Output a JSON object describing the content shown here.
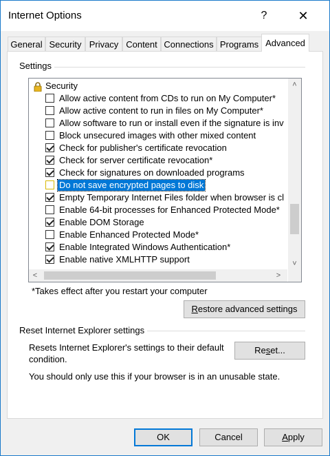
{
  "window": {
    "title": "Internet Options",
    "help_glyph": "?",
    "close_glyph": "✕"
  },
  "tabs": [
    {
      "label": "General"
    },
    {
      "label": "Security"
    },
    {
      "label": "Privacy"
    },
    {
      "label": "Content"
    },
    {
      "label": "Connections"
    },
    {
      "label": "Programs"
    },
    {
      "label": "Advanced",
      "active": true
    }
  ],
  "settings": {
    "group_label": "Settings",
    "category": {
      "label": "Security",
      "icon": "padlock-icon"
    },
    "items": [
      {
        "label": "Allow active content from CDs to run on My Computer*",
        "checked": false
      },
      {
        "label": "Allow active content to run in files on My Computer*",
        "checked": false
      },
      {
        "label": "Allow software to run or install even if the signature is inv",
        "checked": false
      },
      {
        "label": "Block unsecured images with other mixed content",
        "checked": false
      },
      {
        "label": "Check for publisher's certificate revocation",
        "checked": true
      },
      {
        "label": "Check for server certificate revocation*",
        "checked": true
      },
      {
        "label": "Check for signatures on downloaded programs",
        "checked": true
      },
      {
        "label": "Do not save encrypted pages to disk",
        "checked": false,
        "selected": true
      },
      {
        "label": "Empty Temporary Internet Files folder when browser is cl",
        "checked": true
      },
      {
        "label": "Enable 64-bit processes for Enhanced Protected Mode*",
        "checked": false
      },
      {
        "label": "Enable DOM Storage",
        "checked": true
      },
      {
        "label": "Enable Enhanced Protected Mode*",
        "checked": false
      },
      {
        "label": "Enable Integrated Windows Authentication*",
        "checked": true
      },
      {
        "label": "Enable native XMLHTTP support",
        "checked": true
      }
    ],
    "footnote": "*Takes effect after you restart your computer",
    "restore_button": {
      "label_prefix": "",
      "accel": "R",
      "label_rest": "estore advanced settings"
    },
    "scroll": {
      "up": "˄",
      "down": "˅",
      "left": "<",
      "right": ">"
    }
  },
  "reset": {
    "group_label": "Reset Internet Explorer settings",
    "description": "Resets Internet Explorer's settings to their default condition.",
    "description_line1": "Resets Internet Explorer's settings to their default",
    "description_line2": "condition.",
    "warning": "You should only use this if your browser is in an unusable state.",
    "button": {
      "pre": "Re",
      "accel": "s",
      "post": "et..."
    }
  },
  "footer": {
    "ok_label": "OK",
    "cancel_label": "Cancel",
    "apply": {
      "accel": "A",
      "rest": "pply"
    }
  },
  "colors": {
    "accent": "#0078d7",
    "selection": "#0078d7",
    "window_border": "#1979ca"
  }
}
